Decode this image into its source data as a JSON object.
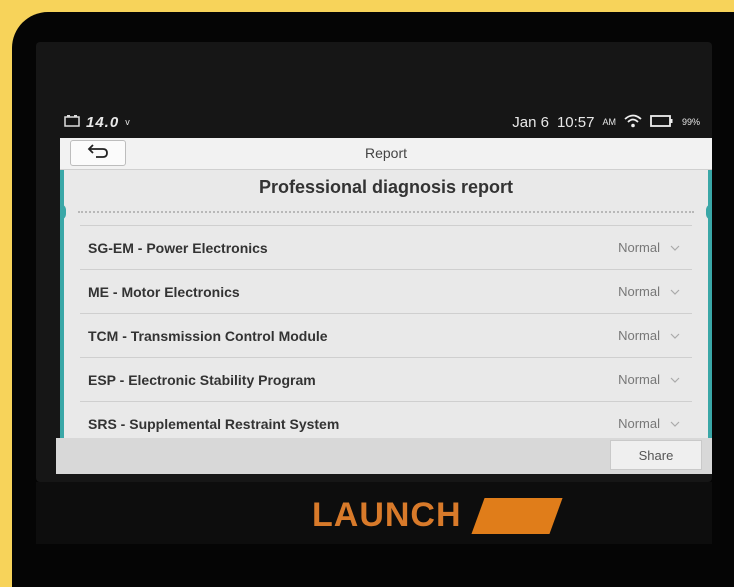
{
  "status_bar": {
    "voltage": "14.0",
    "voltage_unit": "v",
    "date": "Jan 6",
    "time": "10:57",
    "time_suffix": "AM",
    "battery": "99%"
  },
  "header": {
    "title": "Report",
    "back_icon": "back-arrow-icon"
  },
  "report": {
    "title": "Professional diagnosis report",
    "rows": [
      {
        "label": "SG-EM - Power Electronics",
        "status": "Normal"
      },
      {
        "label": "ME - Motor Electronics",
        "status": "Normal"
      },
      {
        "label": "TCM - Transmission Control Module",
        "status": "Normal"
      },
      {
        "label": "ESP - Electronic Stability Program",
        "status": "Normal"
      },
      {
        "label": "SRS - Supplemental Restraint System",
        "status": "Normal"
      }
    ]
  },
  "footer": {
    "share_label": "Share"
  },
  "device": {
    "brand": "LAUNCH"
  },
  "colors": {
    "frame": "#f7d35a",
    "accent": "#3aa7a7",
    "brand": "#d87a2a"
  }
}
